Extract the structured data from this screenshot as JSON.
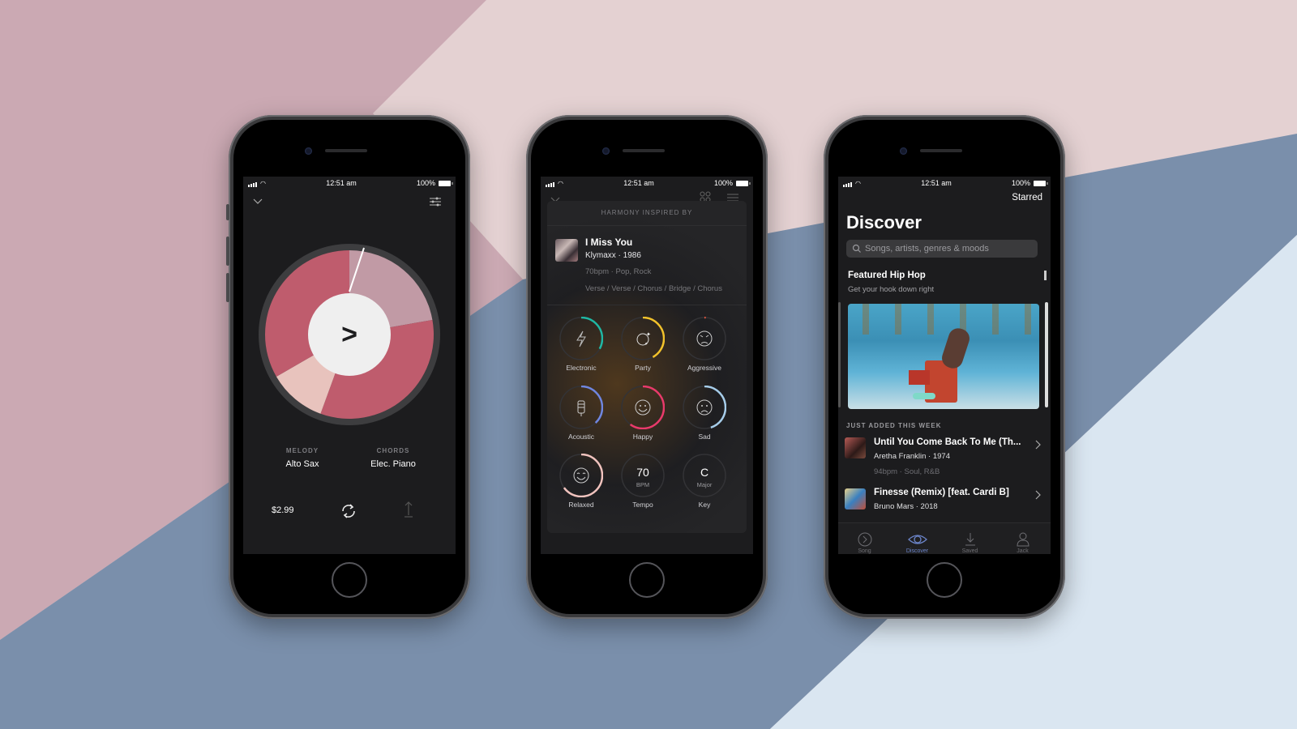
{
  "background": {
    "colors": [
      "#cba9b3",
      "#e4d1d2",
      "#7a8fab",
      "#dae6f1"
    ]
  },
  "status_bar": {
    "time": "12:51 am",
    "battery": "100%"
  },
  "phone1": {
    "melody_label": "MELODY",
    "melody_value": "Alto Sax",
    "chords_label": "CHORDS",
    "chords_value": "Elec. Piano",
    "price": "$2.99",
    "play_glyph": ">",
    "wheel_segments": [
      {
        "name": "top-right",
        "color": "#c19aa5"
      },
      {
        "name": "right",
        "color": "#bf5c6d"
      },
      {
        "name": "bottom-left",
        "color": "#e8c3bd"
      },
      {
        "name": "left",
        "color": "#bf5c6d"
      }
    ]
  },
  "phone2": {
    "header": "HARMONY INSPIRED BY",
    "song_title": "I Miss You",
    "song_artist": "Klymaxx · 1986",
    "song_meta": "70bpm · Pop, Rock",
    "song_structure": "Verse / Verse / Chorus / Bridge / Chorus",
    "moods": [
      {
        "label": "Electronic",
        "icon": "lightning-icon",
        "color": "#1fb7a4",
        "level": 0.33
      },
      {
        "label": "Party",
        "icon": "disco-ball-icon",
        "color": "#f2c22b",
        "level": 0.42
      },
      {
        "label": "Aggressive",
        "icon": "angry-face-icon",
        "color": "#e2553e",
        "level": 0.01
      },
      {
        "label": "Acoustic",
        "icon": "guitar-icon",
        "color": "#6f86e0",
        "level": 0.38
      },
      {
        "label": "Happy",
        "icon": "smile-icon",
        "color": "#e93a6b",
        "level": 0.6
      },
      {
        "label": "Sad",
        "icon": "sad-face-icon",
        "color": "#a6cdea",
        "level": 0.45
      },
      {
        "label": "Relaxed",
        "icon": "relaxed-face-icon",
        "color": "#f1c3be",
        "level": 0.65
      }
    ],
    "tempo": {
      "value": "70",
      "unit": "BPM",
      "label": "Tempo"
    },
    "key": {
      "value": "C",
      "unit": "Major",
      "label": "Key"
    }
  },
  "phone3": {
    "starred": "Starred",
    "title": "Discover",
    "search_placeholder": "Songs, artists, genres & moods",
    "featured_title": "Featured Hip Hop",
    "featured_subtitle": "Get your hook down right",
    "section_label": "JUST ADDED THIS WEEK",
    "songs": [
      {
        "title": "Until You Come Back To Me (Th...",
        "artist": "Aretha Franklin · 1974",
        "meta": "94bpm · Soul, R&B"
      },
      {
        "title": "Finesse (Remix) [feat. Cardi B]",
        "artist": "Bruno Mars · 2018",
        "meta": ""
      }
    ],
    "tabs": [
      {
        "label": "Song",
        "icon": "play-circle-icon",
        "active": false
      },
      {
        "label": "Discover",
        "icon": "eye-icon",
        "active": true
      },
      {
        "label": "Saved",
        "icon": "download-icon",
        "active": false
      },
      {
        "label": "Jack",
        "icon": "person-icon",
        "active": false
      }
    ],
    "accent": "#6b84c9"
  }
}
